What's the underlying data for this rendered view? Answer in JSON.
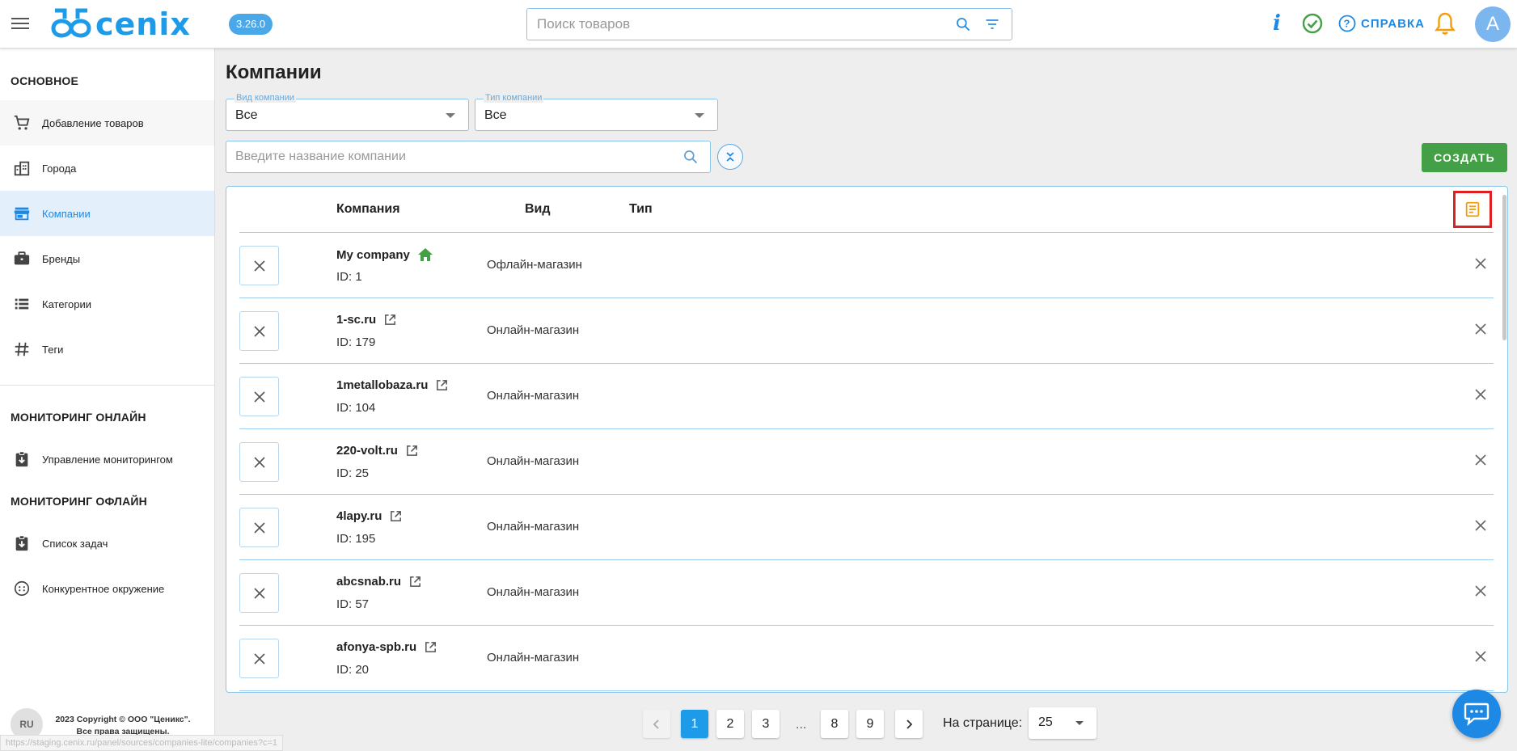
{
  "header": {
    "logo_text": "cenix",
    "version": "3.26.0",
    "search_placeholder": "Поиск товаров",
    "help_label": "СПРАВКА",
    "avatar_letter": "A",
    "accent_color": "#1e88e5",
    "bell_color": "#f59e0b",
    "check_color": "#43a047"
  },
  "sidebar": {
    "sections": [
      {
        "title": "ОСНОВНОЕ"
      },
      {
        "title": "МОНИТОРИНГ ОНЛАЙН"
      },
      {
        "title": "МОНИТОРИНГ ОФЛАЙН"
      }
    ],
    "items": [
      {
        "label": "Добавление товаров",
        "icon": "cart-icon"
      },
      {
        "label": "Города",
        "icon": "city-icon"
      },
      {
        "label": "Компании",
        "icon": "store-icon",
        "active": true
      },
      {
        "label": "Бренды",
        "icon": "briefcase-icon"
      },
      {
        "label": "Категории",
        "icon": "list-icon"
      },
      {
        "label": "Теги",
        "icon": "hashtag-icon"
      },
      {
        "label": "Управление мониторингом",
        "icon": "clipboard-download-icon"
      },
      {
        "label": "Список задач",
        "icon": "clipboard-download-icon"
      },
      {
        "label": "Конкурентное окружение",
        "icon": "dots-circle-icon"
      }
    ],
    "footer": {
      "lang": "RU",
      "copyright_line1": "2023 Copyright © ООО \"Ценикс\".",
      "copyright_line2": "Все права защищены."
    },
    "status_url": "https://staging.cenix.ru/panel/sources/companies-lite/companies?c=1"
  },
  "main": {
    "title": "Компании",
    "filters": {
      "kind_label": "Вид компании",
      "kind_value": "Все",
      "type_label": "Тип компании",
      "type_value": "Все"
    },
    "search_placeholder": "Введите название компании",
    "create_label": "СОЗДАТЬ",
    "table": {
      "columns": [
        "Компания",
        "Вид",
        "Тип"
      ],
      "rows": [
        {
          "name": "My company",
          "id": "ID: 1",
          "kind": "Офлайн-магазин",
          "icon": "home-icon"
        },
        {
          "name": "1-sc.ru",
          "id": "ID: 179",
          "kind": "Онлайн-магазин",
          "icon": "external-link-icon"
        },
        {
          "name": "1metallobaza.ru",
          "id": "ID: 104",
          "kind": "Онлайн-магазин",
          "icon": "external-link-icon"
        },
        {
          "name": "220-volt.ru",
          "id": "ID: 25",
          "kind": "Онлайн-магазин",
          "icon": "external-link-icon"
        },
        {
          "name": "4lapy.ru",
          "id": "ID: 195",
          "kind": "Онлайн-магазин",
          "icon": "external-link-icon"
        },
        {
          "name": "abcsnab.ru",
          "id": "ID: 57",
          "kind": "Онлайн-магазин",
          "icon": "external-link-icon"
        },
        {
          "name": "afonya-spb.ru",
          "id": "ID: 20",
          "kind": "Онлайн-магазин",
          "icon": "external-link-icon"
        }
      ]
    },
    "pagination": {
      "pages": [
        "1",
        "2",
        "3",
        "8",
        "9"
      ],
      "current": "1",
      "ellipsis": "...",
      "per_page_label": "На странице:",
      "per_page_value": "25"
    }
  }
}
